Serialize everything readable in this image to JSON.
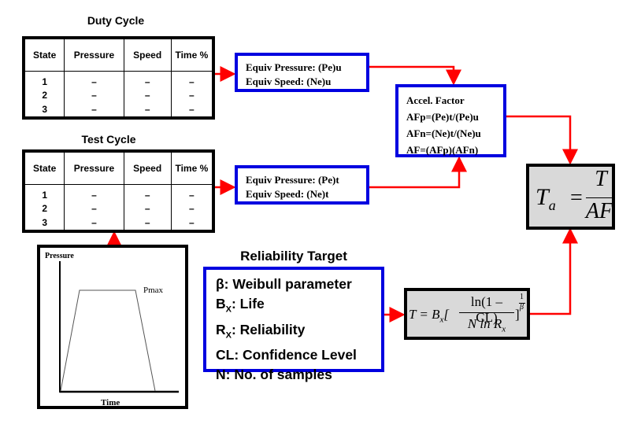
{
  "colors": {
    "arrow": "#ff0000",
    "box_border": "#0000e0",
    "formula_bg": "#d9d9d9"
  },
  "duty_cycle": {
    "title": "Duty Cycle",
    "headers": [
      "State",
      "Pressure",
      "Speed",
      "Time %"
    ],
    "rows": [
      [
        "1",
        "–",
        "–",
        "–"
      ],
      [
        "2",
        "–",
        "–",
        "–"
      ],
      [
        "3",
        "–",
        "–",
        "–"
      ]
    ]
  },
  "test_cycle": {
    "title": "Test Cycle",
    "headers": [
      "State",
      "Pressure",
      "Speed",
      "Time %"
    ],
    "rows": [
      [
        "1",
        "–",
        "–",
        "–"
      ],
      [
        "2",
        "–",
        "–",
        "–"
      ],
      [
        "3",
        "–",
        "–",
        "–"
      ]
    ]
  },
  "equiv_use": {
    "line1": "Equiv Pressure: (Pe)u",
    "line2": "Equiv Speed: (Ne)u"
  },
  "equiv_test": {
    "line1": "Equiv Pressure: (Pe)t",
    "line2": "Equiv Speed: (Ne)t"
  },
  "accel": {
    "title": "Accel. Factor",
    "lines": [
      "AFp=(Pe)t/(Pe)u",
      "AFn=(Ne)t/(Ne)u",
      "AF=(AFp)(AFn)"
    ]
  },
  "ta_formula": {
    "lhs": "T",
    "lhs_sub": "a",
    "eq": "=",
    "num": "T",
    "den": "AF"
  },
  "t_formula": {
    "lhs": "T = B",
    "sub": "x",
    "num": "ln(1 – CL)",
    "den": "N ln R",
    "den_sub": "x",
    "exp_num": "1",
    "exp_den": "β"
  },
  "reliability": {
    "title": "Reliability Target",
    "items": [
      {
        "main": "β: Weibull parameter",
        "sub": ""
      },
      {
        "main": "B",
        "sub": "X",
        "rest": ": Life"
      },
      {
        "main": "R",
        "sub": "X",
        "rest": ": Reliability"
      },
      {
        "main": "CL: Confidence Level",
        "sub": ""
      },
      {
        "main": "N: No. of samples",
        "sub": ""
      }
    ]
  },
  "pressure_profile": {
    "ylabel": "Pressure",
    "xlabel": "Time",
    "peak_label": "Pmax"
  }
}
